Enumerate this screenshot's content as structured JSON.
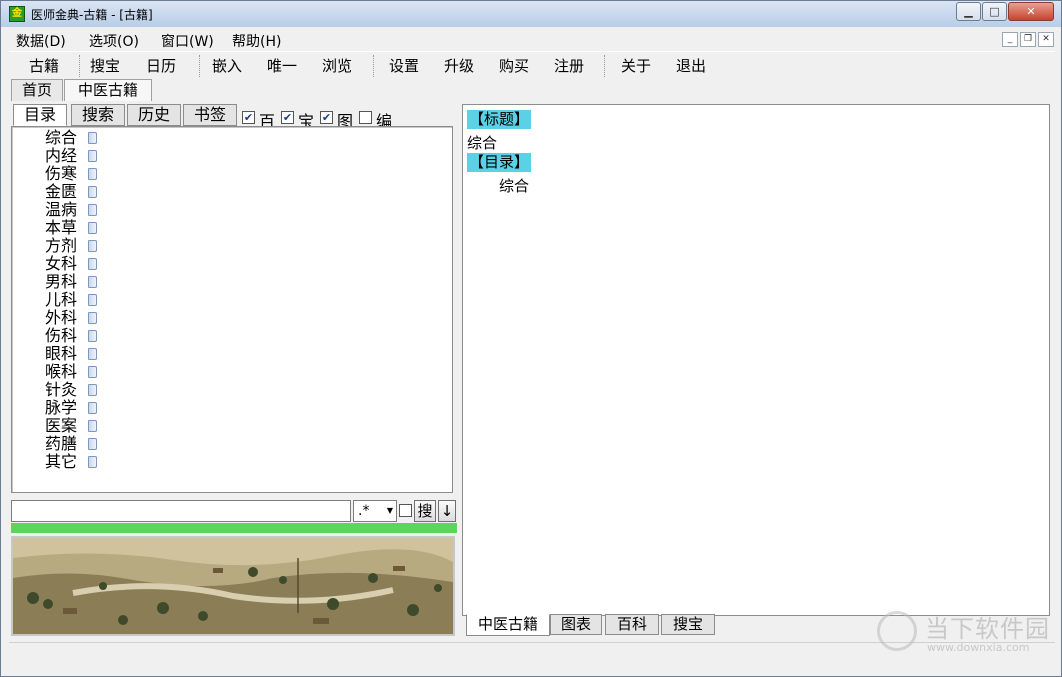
{
  "window": {
    "title": "医师金典-古籍 - [古籍]",
    "icon": "app-logo-icon",
    "icon_text": "金"
  },
  "menubar": {
    "items": [
      "数据(D)",
      "选项(O)",
      "窗口(W)",
      "帮助(H)"
    ]
  },
  "toolbar": {
    "items": [
      "古籍",
      "搜宝",
      "日历",
      "嵌入",
      "唯一",
      "浏览",
      "设置",
      "升级",
      "购买",
      "注册",
      "关于",
      "退出"
    ]
  },
  "doc_tabs": [
    "首页",
    "中医古籍"
  ],
  "left": {
    "tabs": [
      "目录",
      "搜索",
      "历史",
      "书签"
    ],
    "checkboxes": [
      {
        "label": "百",
        "checked": true
      },
      {
        "label": "宝",
        "checked": true
      },
      {
        "label": "图",
        "checked": true
      },
      {
        "label": "编",
        "checked": false
      }
    ],
    "tree": [
      "综合",
      "内经",
      "伤寒",
      "金匮",
      "温病",
      "本草",
      "方剂",
      "女科",
      "男科",
      "儿科",
      "外科",
      "伤科",
      "眼科",
      "喉科",
      "针灸",
      "脉学",
      "医案",
      "药膳",
      "其它"
    ],
    "search": {
      "value": "",
      "regex": ".*",
      "search_button": "搜",
      "down_button": "↓"
    },
    "progress": 1.0
  },
  "right": {
    "title_tag": "【标题】",
    "title_value": "综合",
    "toc_tag": "【目录】",
    "toc_items": [
      "综合"
    ]
  },
  "bottom_tabs": [
    "中医古籍",
    "图表",
    "百科",
    "搜宝"
  ],
  "watermark": {
    "text": "当下软件园",
    "url": "www.downxia.com"
  },
  "colors": {
    "heading_tag_bg": "#5ad1e6",
    "progress_green": "#5bd55b",
    "close_red": "#c7422f"
  }
}
